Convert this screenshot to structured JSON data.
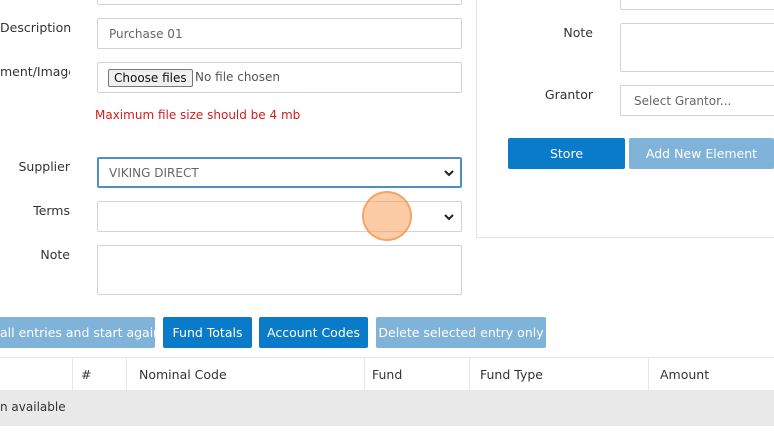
{
  "form": {
    "top_stub_placeholder": "",
    "description": {
      "label": "Description",
      "value": "Purchase 01"
    },
    "attachment": {
      "label": "ment/Images",
      "button_label": "Choose files",
      "status_text": "No file chosen",
      "error_text": "Maximum file size should be 4 mb"
    },
    "supplier": {
      "label": "Supplier",
      "selected": "VIKING DIRECT"
    },
    "terms": {
      "label": "Terms",
      "selected": ""
    },
    "note": {
      "label": "Note",
      "value": ""
    }
  },
  "right_panel": {
    "note_label": "Note",
    "grantor_label": "Grantor",
    "grantor_placeholder": "Select Grantor...",
    "store_label": "Store",
    "add_new_label": "Add New Element"
  },
  "actions": {
    "clear_label": "all entries and start again",
    "fund_totals_label": "Fund Totals",
    "account_codes_label": "Account Codes",
    "delete_entry_label": "Delete selected entry only"
  },
  "table": {
    "columns": [
      "#",
      "Nominal Code",
      "Fund",
      "Fund Type",
      "Amount"
    ],
    "empty_text": "n available"
  },
  "colors": {
    "primary": "#0a7bc9",
    "muted_button": "#7fb3da",
    "error": "#d11d1d",
    "supplier_border": "#4f8fc6",
    "cursor_ring": "#f7a35c"
  },
  "icons": {
    "select_arrow": "chevron-down-icon",
    "cursor": "click-indicator"
  }
}
